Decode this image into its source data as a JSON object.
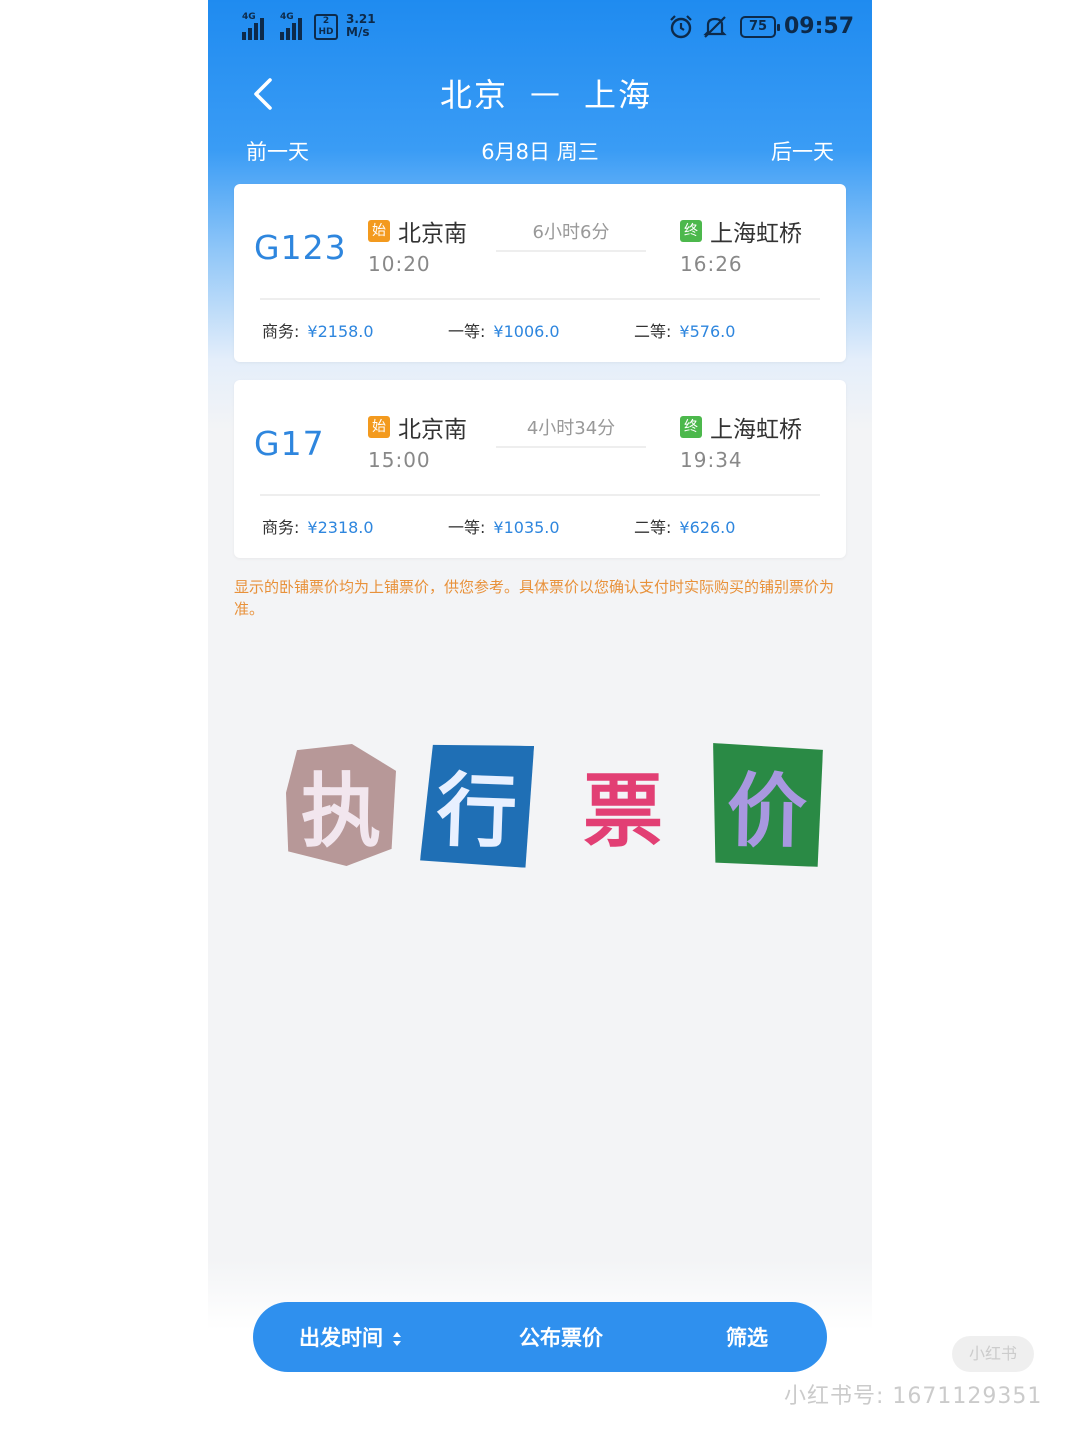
{
  "status_bar": {
    "signal1_tag": "4G",
    "signal2_tag": "4G",
    "hd_top": "2",
    "hd_bottom": "HD",
    "speed_value": "3.21",
    "speed_unit": "M/s",
    "battery": "75",
    "time": "09:57",
    "icons": [
      "alarm-icon",
      "mute-icon"
    ]
  },
  "header": {
    "from": "北京",
    "arrow": "—",
    "to": "上海",
    "prev_day": "前一天",
    "date": "6月8日 周三",
    "next_day": "后一天"
  },
  "trains": [
    {
      "number": "G123",
      "start_badge": "始",
      "from_station": "北京南",
      "depart_time": "10:20",
      "duration": "6小时6分",
      "end_badge": "终",
      "to_station": "上海虹桥",
      "arrive_time": "16:26",
      "prices": [
        {
          "label": "商务:",
          "amount": "¥2158.0"
        },
        {
          "label": "一等:",
          "amount": "¥1006.0"
        },
        {
          "label": "二等:",
          "amount": "¥576.0"
        }
      ]
    },
    {
      "number": "G17",
      "start_badge": "始",
      "from_station": "北京南",
      "depart_time": "15:00",
      "duration": "4小时34分",
      "end_badge": "终",
      "to_station": "上海虹桥",
      "arrive_time": "19:34",
      "prices": [
        {
          "label": "商务:",
          "amount": "¥2318.0"
        },
        {
          "label": "一等:",
          "amount": "¥1035.0"
        },
        {
          "label": "二等:",
          "amount": "¥626.0"
        }
      ]
    }
  ],
  "notice": "显示的卧铺票价均为上铺票价，供您参考。具体票价以您确认支付时实际购买的铺别票价为准。",
  "sticker_text": [
    "执",
    "行",
    "票",
    "价"
  ],
  "bottom_bar": {
    "depart_time": "出发时间",
    "published_price": "公布票价",
    "filter": "筛选"
  },
  "watermark": {
    "logo": "小红书",
    "id": "小红书号: 1671129351"
  },
  "colors": {
    "header_blue": "#1f8bf0",
    "train_number": "#2e86de",
    "start_badge": "#f39a1e",
    "end_badge": "#4cb84c",
    "notice": "#e8913a",
    "bottom_bar": "#2f90ee"
  }
}
